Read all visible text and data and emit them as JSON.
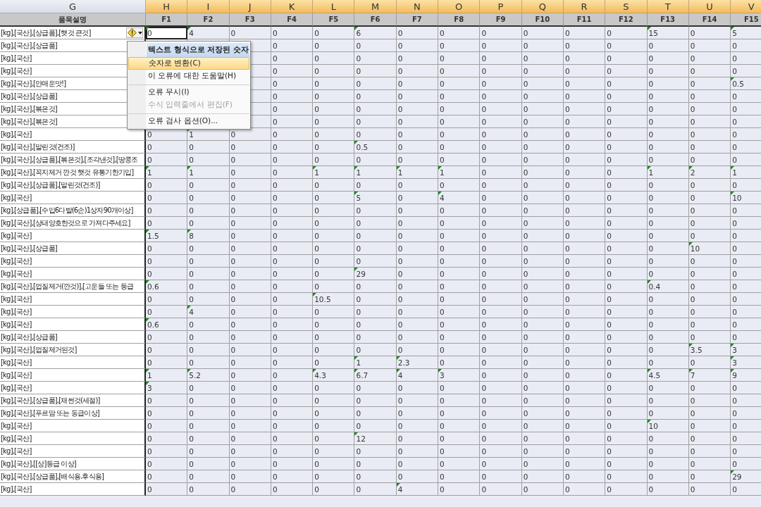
{
  "columns": [
    {
      "letter": "G",
      "field": "품목설명",
      "selected": false
    },
    {
      "letter": "H",
      "field": "F1",
      "selected": true
    },
    {
      "letter": "I",
      "field": "F2",
      "selected": true
    },
    {
      "letter": "J",
      "field": "F3",
      "selected": true
    },
    {
      "letter": "K",
      "field": "F4",
      "selected": true
    },
    {
      "letter": "L",
      "field": "F5",
      "selected": true
    },
    {
      "letter": "M",
      "field": "F6",
      "selected": true
    },
    {
      "letter": "N",
      "field": "F7",
      "selected": true
    },
    {
      "letter": "O",
      "field": "F8",
      "selected": true
    },
    {
      "letter": "P",
      "field": "F9",
      "selected": true
    },
    {
      "letter": "Q",
      "field": "F10",
      "selected": true
    },
    {
      "letter": "R",
      "field": "F11",
      "selected": true
    },
    {
      "letter": "S",
      "field": "F12",
      "selected": true
    },
    {
      "letter": "T",
      "field": "F13",
      "selected": true
    },
    {
      "letter": "U",
      "field": "F14",
      "selected": true
    },
    {
      "letter": "V",
      "field": "F15",
      "selected": true
    }
  ],
  "rows": [
    {
      "description": "[kg],[국산],[상급품],[햇것 큰것]",
      "active": true,
      "values": [
        "0",
        "4",
        "0",
        "0",
        "0",
        "6",
        "0",
        "0",
        "0",
        "0",
        "0",
        "0",
        "15",
        "0",
        "5"
      ],
      "flagged": [
        true,
        true,
        false,
        false,
        false,
        true,
        false,
        false,
        false,
        false,
        false,
        false,
        true,
        false,
        true
      ]
    },
    {
      "description": "[kg],[국산],[상급품]",
      "active": false,
      "values": [
        "0",
        "0",
        "0",
        "0",
        "0",
        "0",
        "0",
        "0",
        "0",
        "0",
        "0",
        "0"
      ],
      "flagged": [
        false,
        false,
        false,
        false,
        false,
        false,
        false,
        false,
        false,
        false,
        false,
        false
      ]
    },
    {
      "description": "[kg],[국산]",
      "active": false,
      "values": [
        "0",
        "0",
        "0",
        "0",
        "0",
        "0",
        "0",
        "0",
        "0",
        "0",
        "0",
        "0"
      ],
      "flagged": [
        false,
        false,
        false,
        false,
        false,
        false,
        false,
        false,
        false,
        false,
        false,
        false
      ]
    },
    {
      "description": "[kg],[국산]",
      "active": false,
      "values": [
        "0",
        "0",
        "0",
        "0",
        "0",
        "0",
        "0",
        "0",
        "0",
        "0",
        "0",
        "0"
      ],
      "flagged": [
        false,
        false,
        false,
        false,
        false,
        false,
        false,
        false,
        false,
        false,
        false,
        false
      ]
    },
    {
      "description": "[kg],[국산],[안매운맛!]",
      "active": false,
      "values": [
        "0",
        "0",
        "0",
        "0",
        "0",
        "0",
        "0",
        "0",
        "0",
        "0",
        "0",
        "0.5"
      ],
      "flagged": [
        false,
        false,
        false,
        false,
        false,
        false,
        false,
        false,
        false,
        false,
        false,
        true
      ]
    },
    {
      "description": "[kg],[국산],[상급품]",
      "active": false,
      "values": [
        "0",
        "0",
        "0",
        "0",
        "0",
        "0",
        "0",
        "0",
        "0",
        "0",
        "0",
        "0"
      ],
      "flagged": [
        false,
        false,
        false,
        false,
        false,
        false,
        false,
        false,
        false,
        false,
        false,
        false
      ]
    },
    {
      "description": "[kg],[국산],[볶은것]",
      "active": false,
      "values": [
        "0",
        "0",
        "0",
        "0",
        "0",
        "0",
        "0",
        "0",
        "0",
        "0",
        "0",
        "0"
      ],
      "flagged": [
        false,
        false,
        false,
        false,
        false,
        false,
        false,
        false,
        false,
        false,
        false,
        false
      ]
    },
    {
      "description": "[kg],[국산],[볶은것]",
      "active": false,
      "values": [
        "0",
        "0",
        "0",
        "0",
        "0",
        "0",
        "0",
        "0",
        "0",
        "0",
        "0",
        "0"
      ],
      "flagged": [
        false,
        false,
        false,
        false,
        false,
        false,
        false,
        false,
        false,
        false,
        false,
        false
      ]
    },
    {
      "description": "[kg],[국산]",
      "active": false,
      "values": [
        "0",
        "1",
        "0",
        "0",
        "0",
        "0",
        "0",
        "0",
        "0",
        "0",
        "0",
        "0",
        "0",
        "0",
        "0"
      ],
      "flagged": [
        false,
        true,
        false,
        false,
        false,
        false,
        false,
        false,
        false,
        false,
        false,
        false,
        false,
        false,
        false
      ]
    },
    {
      "description": "[kg],[국산],[말린것(건조)]",
      "active": false,
      "values": [
        "0",
        "0",
        "0",
        "0",
        "0",
        "0.5",
        "0",
        "0",
        "0",
        "0",
        "0",
        "0",
        "0",
        "0",
        "0"
      ],
      "flagged": [
        false,
        false,
        false,
        false,
        false,
        true,
        false,
        false,
        false,
        false,
        false,
        false,
        false,
        false,
        false
      ]
    },
    {
      "description": "[kg],[국산],[상급품],[볶은것],[조각낸것],[땅콩조",
      "active": false,
      "values": [
        "0",
        "0",
        "0",
        "0",
        "0",
        "0",
        "0",
        "0",
        "0",
        "0",
        "0",
        "0",
        "0",
        "0",
        "0"
      ],
      "flagged": [
        false,
        false,
        false,
        false,
        false,
        false,
        false,
        false,
        false,
        false,
        false,
        false,
        false,
        false,
        false
      ]
    },
    {
      "description": "[kg],[국산],[꼭지제거 깐것 햇것 유통기한기입]",
      "active": false,
      "values": [
        "1",
        "1",
        "0",
        "0",
        "1",
        "1",
        "1",
        "1",
        "0",
        "0",
        "0",
        "0",
        "1",
        "2",
        "1"
      ],
      "flagged": [
        true,
        true,
        false,
        false,
        true,
        true,
        true,
        true,
        false,
        false,
        false,
        false,
        true,
        true,
        true
      ]
    },
    {
      "description": "[kg],[국산],[상급품],[말린것(건조)]",
      "active": false,
      "values": [
        "0",
        "0",
        "0",
        "0",
        "0",
        "0",
        "0",
        "0",
        "0",
        "0",
        "0",
        "0",
        "0",
        "0",
        "0"
      ],
      "flagged": [
        false,
        false,
        false,
        false,
        false,
        false,
        false,
        false,
        false,
        false,
        false,
        false,
        false,
        false,
        false
      ]
    },
    {
      "description": "[kg],[국산]",
      "active": false,
      "values": [
        "0",
        "0",
        "0",
        "0",
        "0",
        "5",
        "0",
        "4",
        "0",
        "0",
        "0",
        "0",
        "0",
        "0",
        "10"
      ],
      "flagged": [
        false,
        false,
        false,
        false,
        false,
        true,
        false,
        true,
        false,
        false,
        false,
        false,
        false,
        false,
        true
      ]
    },
    {
      "description": "[kg],[상급품],[수입6다발(6손)1상자90개이상]",
      "active": false,
      "values": [
        "0",
        "0",
        "0",
        "0",
        "0",
        "0",
        "0",
        "0",
        "0",
        "0",
        "0",
        "0",
        "0",
        "0",
        "0"
      ],
      "flagged": [
        false,
        false,
        false,
        false,
        false,
        false,
        false,
        false,
        false,
        false,
        false,
        false,
        false,
        false,
        false
      ]
    },
    {
      "description": "[kg],[국산],[상태양호한것으로 가져다주세요]",
      "active": false,
      "values": [
        "0",
        "0",
        "0",
        "0",
        "0",
        "0",
        "0",
        "0",
        "0",
        "0",
        "0",
        "0",
        "0",
        "0",
        "0"
      ],
      "flagged": [
        false,
        false,
        false,
        false,
        false,
        false,
        false,
        false,
        false,
        false,
        false,
        false,
        false,
        false,
        false
      ]
    },
    {
      "description": "[kg],[국산]",
      "active": false,
      "values": [
        "1.5",
        "8",
        "0",
        "0",
        "0",
        "0",
        "0",
        "0",
        "0",
        "0",
        "0",
        "0",
        "0",
        "0",
        "0"
      ],
      "flagged": [
        true,
        true,
        false,
        false,
        false,
        false,
        false,
        false,
        false,
        false,
        false,
        false,
        false,
        false,
        false
      ]
    },
    {
      "description": "[kg],[국산],[상급품]",
      "active": false,
      "values": [
        "0",
        "0",
        "0",
        "0",
        "0",
        "0",
        "0",
        "0",
        "0",
        "0",
        "0",
        "0",
        "0",
        "10",
        "0"
      ],
      "flagged": [
        false,
        false,
        false,
        false,
        false,
        false,
        false,
        false,
        false,
        false,
        false,
        false,
        false,
        true,
        false
      ]
    },
    {
      "description": "[kg],[국산]",
      "active": false,
      "values": [
        "0",
        "0",
        "0",
        "0",
        "0",
        "0",
        "0",
        "0",
        "0",
        "0",
        "0",
        "0",
        "0",
        "0",
        "0"
      ],
      "flagged": [
        false,
        false,
        false,
        false,
        false,
        false,
        false,
        false,
        false,
        false,
        false,
        false,
        false,
        false,
        false
      ]
    },
    {
      "description": "[kg],[국산]",
      "active": false,
      "values": [
        "0",
        "0",
        "0",
        "0",
        "0",
        "29",
        "0",
        "0",
        "0",
        "0",
        "0",
        "0",
        "0",
        "0",
        "0"
      ],
      "flagged": [
        false,
        false,
        false,
        false,
        false,
        true,
        false,
        false,
        false,
        false,
        false,
        false,
        false,
        false,
        false
      ]
    },
    {
      "description": "[kg],[국산],[껍질제거(깐것)],[고운들 또는 등급",
      "active": false,
      "values": [
        "0.6",
        "0",
        "0",
        "0",
        "0",
        "0",
        "0",
        "0",
        "0",
        "0",
        "0",
        "0",
        "0.4",
        "0",
        "0"
      ],
      "flagged": [
        true,
        false,
        false,
        false,
        false,
        false,
        false,
        false,
        false,
        false,
        false,
        false,
        true,
        false,
        false
      ]
    },
    {
      "description": "[kg],[국산]",
      "active": false,
      "values": [
        "0",
        "0",
        "0",
        "0",
        "10.5",
        "0",
        "0",
        "0",
        "0",
        "0",
        "0",
        "0",
        "0",
        "0",
        "0"
      ],
      "flagged": [
        false,
        false,
        false,
        false,
        true,
        false,
        false,
        false,
        false,
        false,
        false,
        false,
        false,
        false,
        false
      ]
    },
    {
      "description": "[kg],[국산]",
      "active": false,
      "values": [
        "0",
        "4",
        "0",
        "0",
        "0",
        "0",
        "0",
        "0",
        "0",
        "0",
        "0",
        "0",
        "0",
        "0",
        "0"
      ],
      "flagged": [
        false,
        true,
        false,
        false,
        false,
        false,
        false,
        false,
        false,
        false,
        false,
        false,
        false,
        false,
        false
      ]
    },
    {
      "description": "[kg],[국산]",
      "active": false,
      "values": [
        "0.6",
        "0",
        "0",
        "0",
        "0",
        "0",
        "0",
        "0",
        "0",
        "0",
        "0",
        "0",
        "0",
        "0",
        "0"
      ],
      "flagged": [
        true,
        false,
        false,
        false,
        false,
        false,
        false,
        false,
        false,
        false,
        false,
        false,
        false,
        false,
        false
      ]
    },
    {
      "description": "[kg],[국산],[상급품]",
      "active": false,
      "values": [
        "0",
        "0",
        "0",
        "0",
        "0",
        "0",
        "0",
        "0",
        "0",
        "0",
        "0",
        "0",
        "0",
        "0",
        "0"
      ],
      "flagged": [
        false,
        false,
        false,
        false,
        false,
        false,
        false,
        false,
        false,
        false,
        false,
        false,
        false,
        false,
        false
      ]
    },
    {
      "description": "[kg],[국산],[껍질제거된것]",
      "active": false,
      "values": [
        "0",
        "0",
        "0",
        "0",
        "0",
        "0",
        "0",
        "0",
        "0",
        "0",
        "0",
        "0",
        "0",
        "3.5",
        "3"
      ],
      "flagged": [
        false,
        false,
        false,
        false,
        false,
        false,
        false,
        false,
        false,
        false,
        false,
        false,
        false,
        true,
        true
      ]
    },
    {
      "description": "[kg],[국산]",
      "active": false,
      "values": [
        "0",
        "0",
        "0",
        "0",
        "0",
        "1",
        "2.3",
        "0",
        "0",
        "0",
        "0",
        "0",
        "0",
        "0",
        "3"
      ],
      "flagged": [
        false,
        false,
        false,
        false,
        false,
        true,
        true,
        false,
        false,
        false,
        false,
        false,
        false,
        false,
        true
      ]
    },
    {
      "description": "[kg],[국산]",
      "active": false,
      "values": [
        "1",
        "5.2",
        "0",
        "0",
        "4.3",
        "6.7",
        "4",
        "3",
        "0",
        "0",
        "0",
        "0",
        "4.5",
        "7",
        "9"
      ],
      "flagged": [
        true,
        true,
        false,
        false,
        true,
        true,
        true,
        true,
        false,
        false,
        false,
        false,
        true,
        true,
        true
      ]
    },
    {
      "description": "[kg],[국산]",
      "active": false,
      "values": [
        "3",
        "0",
        "0",
        "0",
        "0",
        "0",
        "0",
        "0",
        "0",
        "0",
        "0",
        "0",
        "0",
        "0",
        "0"
      ],
      "flagged": [
        true,
        false,
        false,
        false,
        false,
        false,
        false,
        false,
        false,
        false,
        false,
        false,
        false,
        false,
        false
      ]
    },
    {
      "description": "[kg],[국산],[상급품],[채썬것(세절)]",
      "active": false,
      "values": [
        "0",
        "0",
        "0",
        "0",
        "0",
        "0",
        "0",
        "0",
        "0",
        "0",
        "0",
        "0",
        "0",
        "0",
        "0"
      ],
      "flagged": [
        false,
        false,
        false,
        false,
        false,
        false,
        false,
        false,
        false,
        false,
        false,
        false,
        false,
        false,
        false
      ]
    },
    {
      "description": "[kg],[국산],[푸르맘 또는 동급이상]",
      "active": false,
      "values": [
        "0",
        "0",
        "0",
        "0",
        "0",
        "0",
        "0",
        "0",
        "0",
        "0",
        "0",
        "0",
        "0",
        "0",
        "0"
      ],
      "flagged": [
        false,
        false,
        false,
        false,
        false,
        false,
        false,
        false,
        false,
        false,
        false,
        false,
        false,
        false,
        false
      ]
    },
    {
      "description": "[kg],[국산]",
      "active": false,
      "values": [
        "0",
        "0",
        "0",
        "0",
        "0",
        "0",
        "0",
        "0",
        "0",
        "0",
        "0",
        "0",
        "10",
        "0",
        "0"
      ],
      "flagged": [
        false,
        false,
        false,
        false,
        false,
        false,
        false,
        false,
        false,
        false,
        false,
        false,
        true,
        false,
        false
      ]
    },
    {
      "description": "[kg],[국산]",
      "active": false,
      "values": [
        "0",
        "0",
        "0",
        "0",
        "0",
        "12",
        "0",
        "0",
        "0",
        "0",
        "0",
        "0",
        "0",
        "0",
        "0"
      ],
      "flagged": [
        false,
        false,
        false,
        false,
        false,
        true,
        false,
        false,
        false,
        false,
        false,
        false,
        false,
        false,
        false
      ]
    },
    {
      "description": "[kg],[국산]",
      "active": false,
      "values": [
        "0",
        "0",
        "0",
        "0",
        "0",
        "0",
        "0",
        "0",
        "0",
        "0",
        "0",
        "0",
        "0",
        "0",
        "0"
      ],
      "flagged": [
        false,
        false,
        false,
        false,
        false,
        false,
        false,
        false,
        false,
        false,
        false,
        false,
        false,
        false,
        false
      ]
    },
    {
      "description": "[kg],[국산],[[상]등급 이상]",
      "active": false,
      "values": [
        "0",
        "0",
        "0",
        "0",
        "0",
        "0",
        "0",
        "0",
        "0",
        "0",
        "0",
        "0",
        "0",
        "0",
        "0"
      ],
      "flagged": [
        false,
        false,
        false,
        false,
        false,
        false,
        false,
        false,
        false,
        false,
        false,
        false,
        false,
        false,
        false
      ]
    },
    {
      "description": "[kg],[국산],[상급품],[배식용.후식용]",
      "active": false,
      "values": [
        "0",
        "0",
        "0",
        "0",
        "0",
        "0",
        "0",
        "0",
        "0",
        "0",
        "0",
        "0",
        "0",
        "0",
        "29"
      ],
      "flagged": [
        false,
        false,
        false,
        false,
        false,
        false,
        false,
        false,
        false,
        false,
        false,
        false,
        false,
        false,
        true
      ]
    },
    {
      "description": "[kg],[국산]",
      "active": false,
      "values": [
        "0",
        "0",
        "0",
        "0",
        "0",
        "0",
        "4",
        "0",
        "0",
        "0",
        "0",
        "0",
        "0",
        "0",
        "0"
      ],
      "flagged": [
        false,
        false,
        false,
        false,
        false,
        false,
        true,
        false,
        false,
        false,
        false,
        false,
        false,
        false,
        false
      ]
    }
  ],
  "error_menu": {
    "title": "텍스트 형식으로 저장된 숫자",
    "items": [
      {
        "label": "숫자로 변환(C)",
        "selected": true,
        "disabled": false,
        "separator_before": false
      },
      {
        "label": "이 오류에 대한 도움말(H)",
        "selected": false,
        "disabled": false,
        "separator_before": false
      },
      {
        "label": "오류 무시(I)",
        "selected": false,
        "disabled": false,
        "separator_before": true
      },
      {
        "label": "수식 입력줄에서 편집(F)",
        "selected": false,
        "disabled": true,
        "separator_before": false
      },
      {
        "label": "오류 검사 옵션(O)...",
        "selected": false,
        "disabled": false,
        "separator_before": true
      }
    ]
  }
}
